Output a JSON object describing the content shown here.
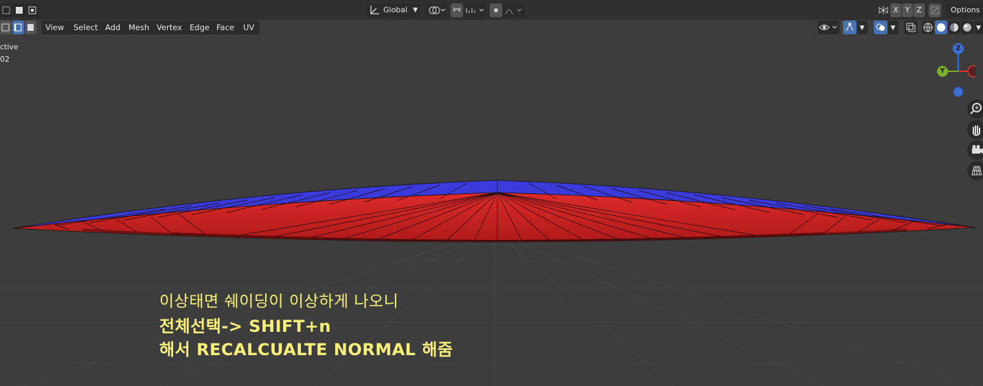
{
  "viewport": {
    "mode_label": "ctive",
    "object_label": "02"
  },
  "header": {
    "transform_orientation": "Global",
    "options_label": "Options",
    "axis_x": "X",
    "axis_y": "Y",
    "axis_z": "Z"
  },
  "menu": {
    "items": [
      "View",
      "Select",
      "Add",
      "Mesh",
      "Vertex",
      "Edge",
      "Face",
      "UV"
    ]
  },
  "gizmo": {
    "z": "Z",
    "y": "Y"
  },
  "annotation": {
    "line1": "이상태면 쉐이딩이 이상하게 나오니",
    "line2": "전체선택-> SHIFT+n",
    "line3": "해서 RECALCUALTE NORMAL 해줌"
  },
  "colors": {
    "background": "#3d3d3d",
    "face_front": "#3b3bdc",
    "face_back": "#dd2a2a",
    "annotation": "#f8f07a",
    "accent": "#4772b3"
  }
}
